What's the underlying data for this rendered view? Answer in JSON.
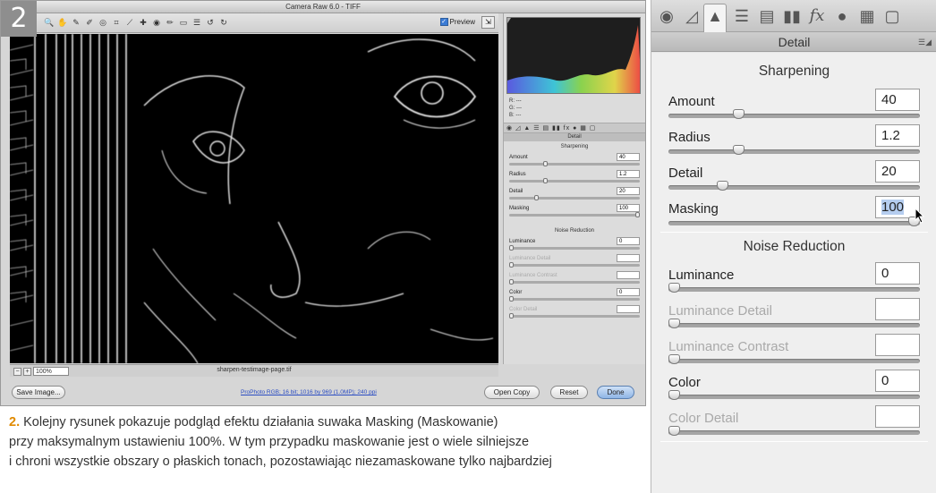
{
  "figure": {
    "number_badge": "2"
  },
  "dialog": {
    "title": "Camera Raw 6.0  -  TIFF",
    "preview_label": "Preview",
    "zoom_value": "100%",
    "filename": "sharpen-testimage-page.tif",
    "workflow_link": "ProPhoto RGB; 16 bit; 1016 by 969 (1.0MP); 240 ppi",
    "buttons": {
      "save": "Save Image...",
      "open_copy": "Open Copy",
      "reset": "Reset",
      "done": "Done"
    },
    "rgb_readout": {
      "r": "R:  ---",
      "g": "G:  ---",
      "b": "B:  ---"
    }
  },
  "panel": {
    "title": "Detail",
    "sharpening": {
      "heading": "Sharpening",
      "sliders": [
        {
          "label": "Amount",
          "value": "40",
          "position": 0.27,
          "enabled": true
        },
        {
          "label": "Radius",
          "value": "1.2",
          "position": 0.27,
          "enabled": true
        },
        {
          "label": "Detail",
          "value": "20",
          "position": 0.2,
          "enabled": true
        },
        {
          "label": "Masking",
          "value": "100",
          "position": 1.0,
          "enabled": true
        }
      ]
    },
    "noise_reduction": {
      "heading": "Noise Reduction",
      "sliders": [
        {
          "label": "Luminance",
          "value": "0",
          "position": 0,
          "enabled": true
        },
        {
          "label": "Luminance Detail",
          "value": "",
          "position": 0,
          "enabled": false
        },
        {
          "label": "Luminance Contrast",
          "value": "",
          "position": 0,
          "enabled": false
        },
        {
          "label": "Color",
          "value": "0",
          "position": 0,
          "enabled": true
        },
        {
          "label": "Color Detail",
          "value": "",
          "position": 0,
          "enabled": false
        }
      ]
    }
  },
  "caption": {
    "number": "2.",
    "line1": "Kolejny rysunek pokazuje podgląd efektu działania suwaka Masking (Maskowanie)",
    "line2": "przy maksymalnym ustawieniu 100%. W tym przypadku maskowanie jest o wiele silniejsze",
    "line3": "i chroni wszystkie obszary o płaskich tonach, pozostawiając niezamaskowane tylko najbardziej"
  },
  "colors": {
    "caption_number": "#e08a00",
    "link": "#2a4cc2",
    "selection": "#b5cdef"
  }
}
